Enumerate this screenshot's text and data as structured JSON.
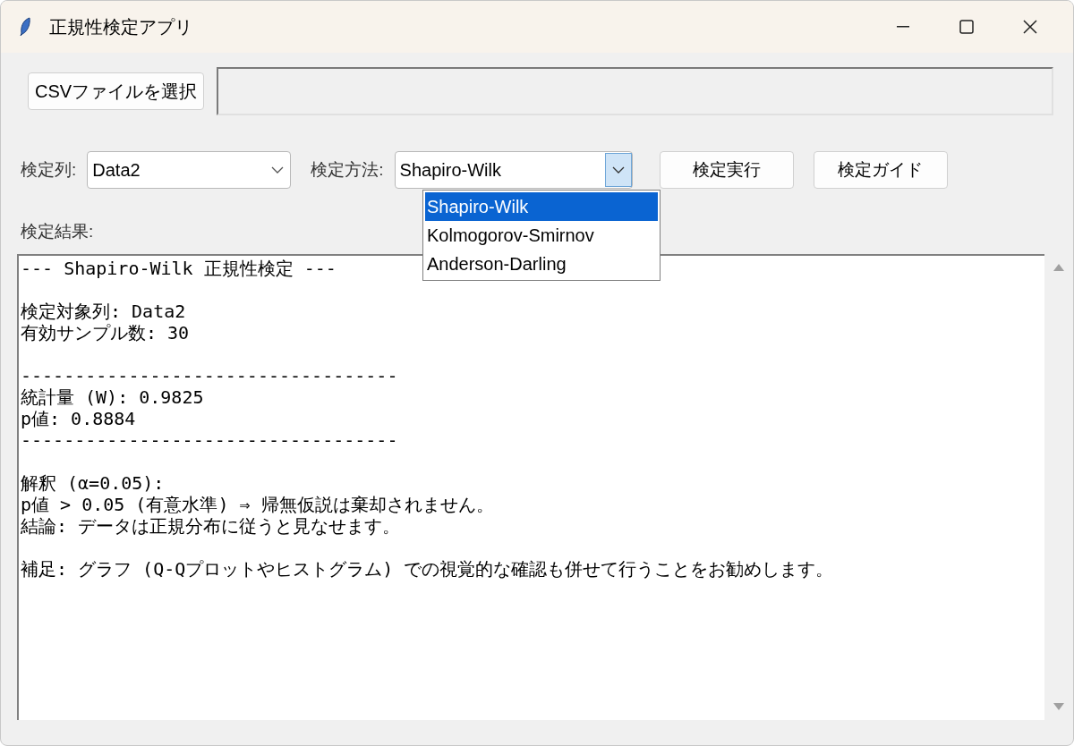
{
  "window": {
    "title": "正規性検定アプリ"
  },
  "file_row": {
    "button": "CSVファイルを選択"
  },
  "controls": {
    "column_label": "検定列:",
    "column_value": "Data2",
    "method_label": "検定方法:",
    "method_value": "Shapiro-Wilk",
    "run_button": "検定実行",
    "guide_button": "検定ガイド"
  },
  "method_options": [
    {
      "label": "Shapiro-Wilk",
      "selected": true
    },
    {
      "label": "Kolmogorov-Smirnov",
      "selected": false
    },
    {
      "label": "Anderson-Darling",
      "selected": false
    }
  ],
  "results": {
    "label": "検定結果:",
    "blocks": [
      [
        "--- Shapiro-Wilk 正規性検定 ---"
      ],
      [
        "検定対象列: Data2",
        "有効サンプル数: 30"
      ],
      [
        "-----------------------------------",
        "統計量 (W): 0.9825",
        "p値: 0.8884",
        "-----------------------------------"
      ],
      [
        "解釈 (α=0.05):",
        "p値 > 0.05 (有意水準) ⇒ 帰無仮説は棄却されません。",
        "結論: データは正規分布に従うと見なせます。"
      ],
      [
        "補足: グラフ (Q-Qプロットやヒストグラム) での視覚的な確認も併せて行うことをお勧めします。"
      ]
    ]
  }
}
